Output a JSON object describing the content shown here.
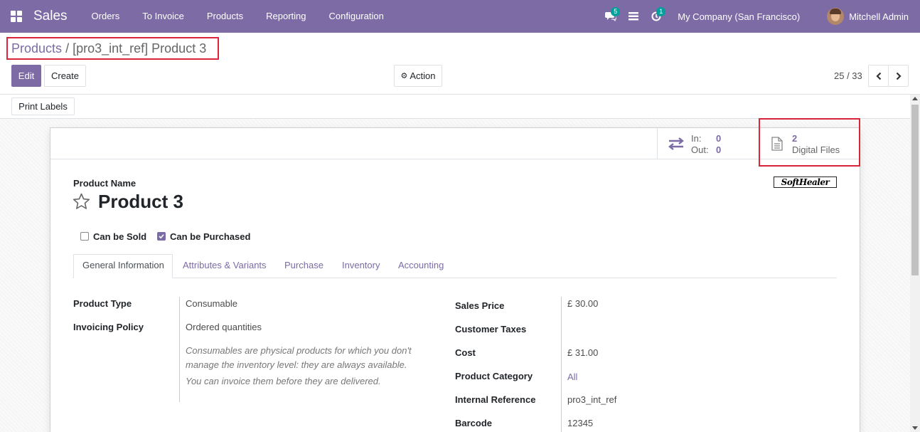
{
  "navbar": {
    "app_name": "Sales",
    "menu": [
      "Orders",
      "To Invoice",
      "Products",
      "Reporting",
      "Configuration"
    ],
    "messages_badge": "5",
    "activity_badge": "1",
    "company": "My Company (San Francisco)",
    "user": "Mitchell Admin"
  },
  "breadcrumb": {
    "parent": "Products",
    "separator": "/",
    "current": "[pro3_int_ref] Product 3"
  },
  "control_panel": {
    "edit_label": "Edit",
    "create_label": "Create",
    "action_label": "Action",
    "pager": "25 / 33",
    "print_labels": "Print Labels"
  },
  "stat_buttons": {
    "in_label": "In:",
    "in_value": "0",
    "out_label": "Out:",
    "out_value": "0",
    "digital_files_count": "2",
    "digital_files_label": "Digital Files"
  },
  "product": {
    "name_label": "Product Name",
    "name": "Product 3",
    "logo_text": "SoftHealer",
    "can_be_sold_label": "Can be Sold",
    "can_be_sold": false,
    "can_be_purchased_label": "Can be Purchased",
    "can_be_purchased": true
  },
  "tabs": [
    "General Information",
    "Attributes & Variants",
    "Purchase",
    "Inventory",
    "Accounting"
  ],
  "general": {
    "product_type_label": "Product Type",
    "product_type": "Consumable",
    "invoicing_policy_label": "Invoicing Policy",
    "invoicing_policy": "Ordered quantities",
    "help_1": "Consumables are physical products for which you don't manage the inventory level: they are always available.",
    "help_2": "You can invoice them before they are delivered.",
    "sales_price_label": "Sales Price",
    "sales_price": "£ 30.00",
    "customer_taxes_label": "Customer Taxes",
    "customer_taxes": "",
    "cost_label": "Cost",
    "cost": "£ 31.00",
    "product_category_label": "Product Category",
    "product_category": "All",
    "internal_reference_label": "Internal Reference",
    "internal_reference": "pro3_int_ref",
    "barcode_label": "Barcode",
    "barcode": "12345"
  },
  "colors": {
    "brand": "#7C6BA5",
    "badge": "#00A09D",
    "highlight": "#D9263B"
  }
}
